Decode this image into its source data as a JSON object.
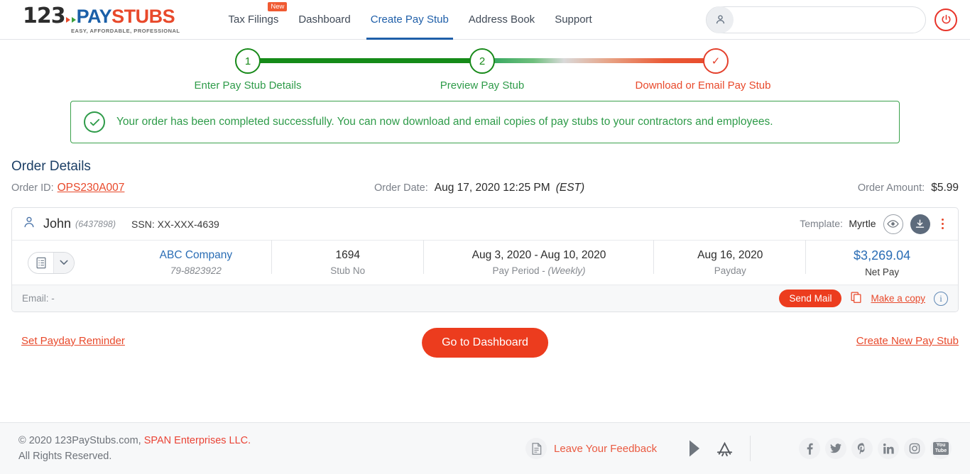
{
  "header": {
    "logo": {
      "num": "123",
      "pay": "PAY",
      "stubs": "STUBS",
      "tagline": "EASY, AFFORDABLE, PROFESSIONAL"
    },
    "nav": [
      {
        "label": "Tax Filings",
        "badge": "New",
        "active": false
      },
      {
        "label": "Dashboard",
        "badge": "",
        "active": false
      },
      {
        "label": "Create Pay Stub",
        "badge": "",
        "active": true
      },
      {
        "label": "Address Book",
        "badge": "",
        "active": false
      },
      {
        "label": "Support",
        "badge": "",
        "active": false
      }
    ],
    "user_field_value": "",
    "user_field_placeholder": "",
    "icons": {
      "user": "user-icon",
      "power": "power-icon"
    }
  },
  "stepper": {
    "steps": [
      {
        "marker": "1",
        "label": "Enter Pay Stub Details",
        "state": "complete"
      },
      {
        "marker": "2",
        "label": "Preview Pay Stub",
        "state": "complete"
      },
      {
        "marker": "✓",
        "label": "Download or Email Pay Stub",
        "state": "current"
      }
    ],
    "colors": {
      "complete": "#188a1a",
      "complete_label": "#2e9b49",
      "current": "#e8492b"
    }
  },
  "alert": {
    "message": "Your order has been completed successfully. You can now download and email copies of pay stubs to your contractors and employees.",
    "color": "#2e9b49",
    "icon": "check-circle-icon"
  },
  "order": {
    "title": "Order Details",
    "id_label": "Order ID:",
    "id_value": "OPS230A007",
    "date_label": "Order Date:",
    "date_value": "Aug 17, 2020 12:25 PM",
    "date_tz": "(EST)",
    "amount_label": "Order Amount:",
    "amount_value": "$5.99"
  },
  "stub": {
    "employee_name": "John",
    "employee_id": "(6437898)",
    "ssn": "SSN: XX-XXX-4639",
    "template_label": "Template:",
    "template_value": "Myrtle",
    "company": "ABC Company",
    "company_ein": "79-8823922",
    "stub_no": "1694",
    "stub_no_label": "Stub No",
    "pay_period": "Aug 3, 2020 - Aug 10, 2020",
    "pay_period_label": "Pay Period - ",
    "pay_period_freq": "(Weekly)",
    "payday": "Aug 16, 2020",
    "payday_label": "Payday",
    "net_pay": "$3,269.04",
    "net_pay_label": "Net Pay",
    "email_text": "Email: -",
    "send_mail_label": "Send Mail",
    "copy_label": "Make a copy",
    "icons": {
      "preview": "eye-icon",
      "download": "download-icon",
      "menu": "kebab-menu-icon",
      "info": "info-icon",
      "copy": "copy-icon",
      "doc": "document-list-icon",
      "chevron": "chevron-down-icon"
    }
  },
  "actions": {
    "reminder": "Set Payday Reminder",
    "dashboard": "Go to Dashboard",
    "new_stub": "Create New Pay Stub"
  },
  "footer": {
    "copyright_pre": "© 2020 123PayStubs.com, ",
    "copyright_span": "SPAN Enterprises LLC.",
    "rights": "All Rights Reserved.",
    "feedback": "Leave Your Feedback",
    "stores": [
      "google-play-icon",
      "app-store-icon"
    ],
    "socials": [
      "facebook-icon",
      "twitter-icon",
      "pinterest-icon",
      "linkedin-icon",
      "instagram-icon",
      "youtube-icon"
    ]
  }
}
